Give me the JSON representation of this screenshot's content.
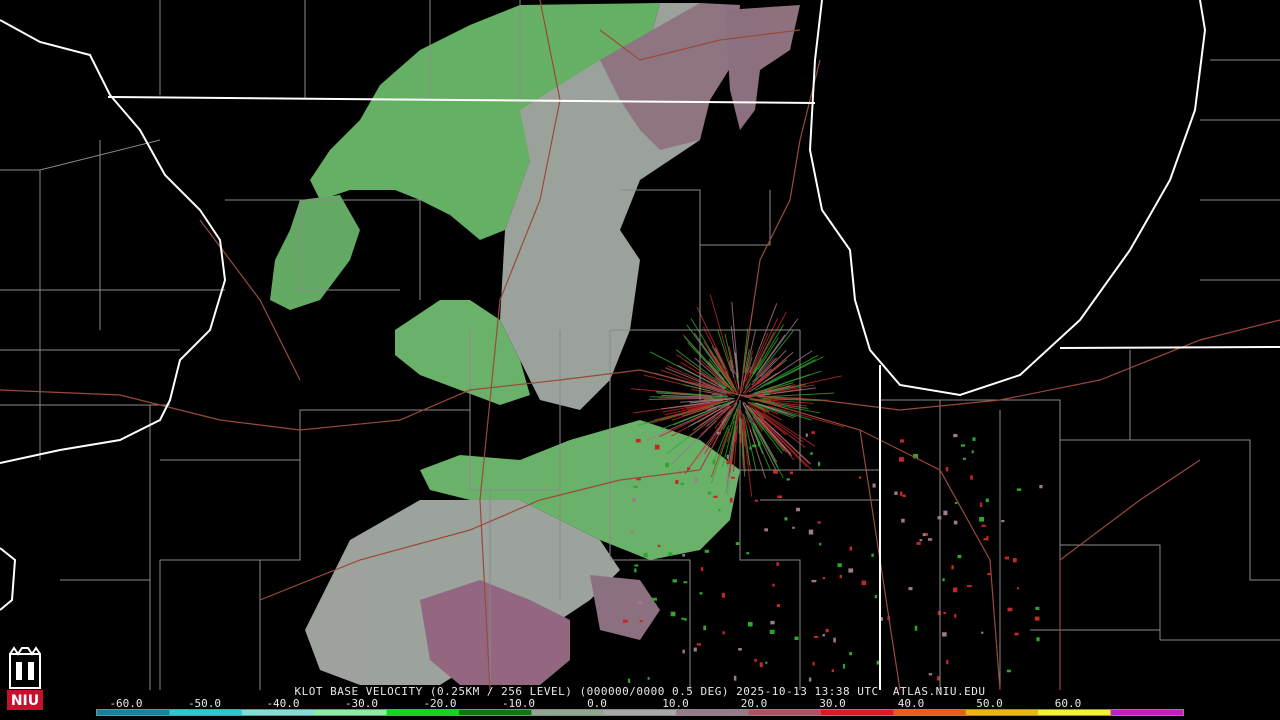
{
  "caption": "KLOT BASE VELOCITY (0.25KM / 256 LEVEL) (000000/0000 0.5 DEG) 2025-10-13 13:38 UTC  ATLAS.NIU.EDU",
  "scale": {
    "ticks": [
      "-60.0",
      "-50.0",
      "-40.0",
      "-30.0",
      "-20.0",
      "-10.0",
      "0.0",
      "10.0",
      "20.0",
      "30.0",
      "40.0",
      "50.0",
      "60.0"
    ],
    "colors": [
      "#1a7fa8",
      "#35c2d8",
      "#7fe0d8",
      "#8af0a0",
      "#20d020",
      "#0a7a0a",
      "#8fa88f",
      "#a8a8a8",
      "#9a7a8a",
      "#b05060",
      "#d02020",
      "#e06020",
      "#f0b020",
      "#f8f040",
      "#c020c0"
    ]
  },
  "logo": {
    "text": "NIU",
    "color": "#c8102e"
  },
  "colors": {
    "background": "#000000",
    "state_border": "#ffffff",
    "county_border": "#8a8a8a",
    "highway": "#9a4a3a",
    "echo_green": "#6fbf6f",
    "echo_gray": "#b0b0b0",
    "echo_mauve": "#a07a8c"
  }
}
